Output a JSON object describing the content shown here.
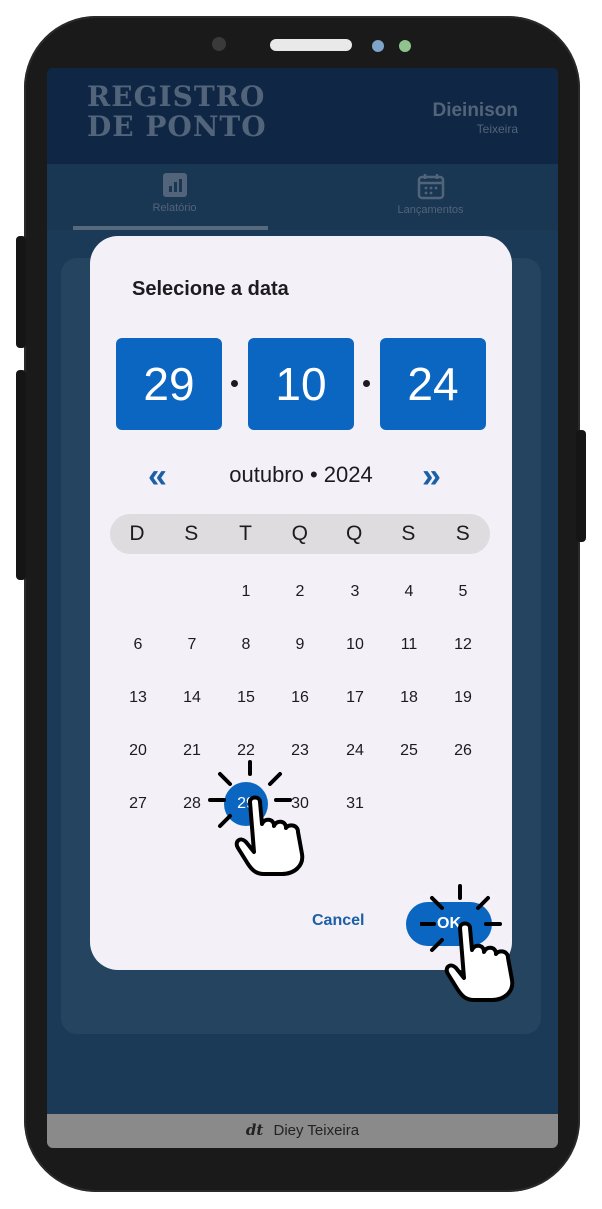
{
  "app": {
    "brand_line1": "REGISTRO",
    "brand_line2": "DE PONTO",
    "user_first": "Dieinison",
    "user_last": "Teixeira"
  },
  "tabs": [
    {
      "label": "Relatório",
      "icon": "bar-chart-icon",
      "active": true
    },
    {
      "label": "Lançamentos",
      "icon": "calendar-icon",
      "active": false
    }
  ],
  "footer": {
    "logo": "dt",
    "name": "Diey Teixeira"
  },
  "dialog": {
    "title": "Selecione a data",
    "day": "29",
    "month": "10",
    "year": "24",
    "month_label": "outubro • 2024",
    "prev_icon": "double-chevron-left-icon",
    "next_icon": "double-chevron-right-icon",
    "weekdays": [
      "D",
      "S",
      "T",
      "Q",
      "Q",
      "S",
      "S"
    ],
    "days": [
      "1",
      "2",
      "3",
      "4",
      "5",
      "6",
      "7",
      "8",
      "9",
      "10",
      "11",
      "12",
      "13",
      "14",
      "15",
      "16",
      "17",
      "18",
      "19",
      "20",
      "21",
      "22",
      "23",
      "24",
      "25",
      "26",
      "27",
      "28",
      "29",
      "30",
      "31"
    ],
    "first_weekday_index": 2,
    "selected_day": "29",
    "cancel_label": "Cancel",
    "ok_label": "OK"
  },
  "colors": {
    "accent": "#0b66c2",
    "dialog_bg": "#f4f0f7",
    "screen_bg": "#1b3a57",
    "topbar_bg": "#0f2744"
  }
}
